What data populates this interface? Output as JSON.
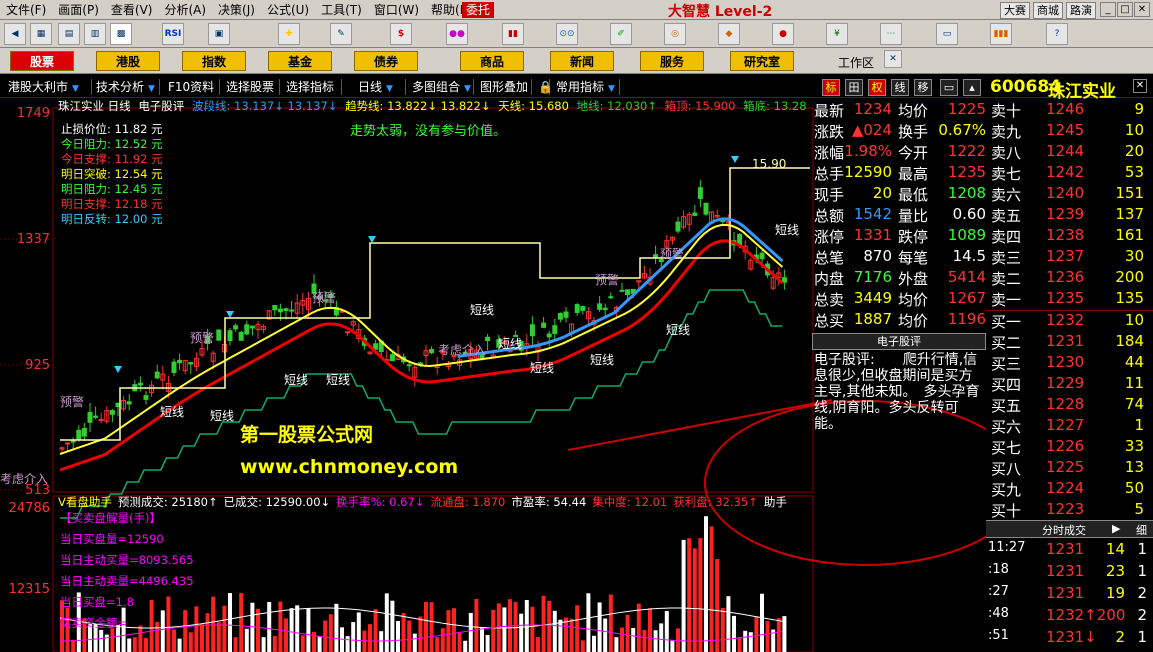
{
  "menu": {
    "items": [
      "文件(F)",
      "画面(P)",
      "查看(V)",
      "分析(A)",
      "决策(J)",
      "公式(U)",
      "工具(T)",
      "窗口(W)",
      "帮助(H)"
    ],
    "weituo": "委托",
    "brand": "大智慧 Level-2",
    "right": [
      "大赛",
      "商城",
      "路演"
    ]
  },
  "toolbar": {
    "rsi": "RSI"
  },
  "categories": [
    "股票",
    "港股",
    "指数",
    "基金",
    "债券",
    "商品",
    "新闻",
    "服务",
    "研究室"
  ],
  "workzone": "工作区",
  "subbar": {
    "items": [
      "港股大利市",
      "技术分析",
      "F10资料",
      "选择股票",
      "选择指标",
      "日线",
      "多图组合",
      "图形叠加",
      "常用指标"
    ],
    "tabs": [
      "标",
      "田",
      "权",
      "线",
      "移"
    ]
  },
  "stock": {
    "code": "600684",
    "name": "珠江实业"
  },
  "chart": {
    "header": [
      {
        "t": "珠江实业 日线",
        "c": "#fff"
      },
      {
        "t": "电子股评",
        "c": "#fff"
      },
      {
        "t": "波段线: 13.137↓ 13.137↓",
        "c": "#39f"
      },
      {
        "t": "趋势线: 13.822↓ 13.822↓",
        "c": "#ff0"
      },
      {
        "t": "天线: 15.680",
        "c": "#ff0"
      },
      {
        "t": "地线: 12.030↑",
        "c": "#3c3"
      },
      {
        "t": "箱顶: 15.900",
        "c": "#f33"
      },
      {
        "t": "箱底: 13.28",
        "c": "#3c3"
      }
    ],
    "note": "走势太弱，没有参与价值。",
    "levels": [
      {
        "t": "止损价位: 11.82 元",
        "c": "#fff"
      },
      {
        "t": "今日阻力: 12.52 元",
        "c": "#3f3"
      },
      {
        "t": "今日支撑: 11.92 元",
        "c": "#f33"
      },
      {
        "t": "明日突破: 12.54 元",
        "c": "#ff0"
      },
      {
        "t": "明日阻力: 12.45 元",
        "c": "#3f3"
      },
      {
        "t": "明日支撑: 12.18 元",
        "c": "#f33"
      },
      {
        "t": "明日反转: 12.00 元",
        "c": "#3cf"
      }
    ],
    "yaxis": [
      "1749",
      "1337",
      "925",
      "513"
    ],
    "labels": {
      "short": "短线",
      "warn": "预警",
      "consider": "考虑介入"
    },
    "peak_label": "15.90",
    "consider_left": "考虑介入",
    "watermark1": "第一股票公式网",
    "watermark2": "www.chnmoney.com"
  },
  "quotes": [
    {
      "k": "最新",
      "v": "1234",
      "vc": "#f33",
      "k2": "均价",
      "v2": "1225",
      "v2c": "#f33"
    },
    {
      "k": "涨跌",
      "v": "▲024",
      "vc": "#f33",
      "k2": "换手",
      "v2": "0.67%",
      "v2c": "#ff0"
    },
    {
      "k": "涨幅",
      "v": "1.98%",
      "vc": "#f33",
      "k2": "今开",
      "v2": "1222",
      "v2c": "#f33"
    },
    {
      "k": "总手",
      "v": "12590",
      "vc": "#ff0",
      "k2": "最高",
      "v2": "1235",
      "v2c": "#f33"
    },
    {
      "k": "现手",
      "v": "20",
      "vc": "#ff0",
      "k2": "最低",
      "v2": "1208",
      "v2c": "#3f3"
    },
    {
      "k": "总额",
      "v": "1542",
      "vc": "#39f",
      "k2": "量比",
      "v2": "0.60",
      "v2c": "#fff"
    },
    {
      "k": "涨停",
      "v": "1331",
      "vc": "#f33",
      "k2": "跌停",
      "v2": "1089",
      "v2c": "#3f3"
    },
    {
      "k": "总笔",
      "v": "870",
      "vc": "#fff",
      "k2": "每笔",
      "v2": "14.5",
      "v2c": "#fff"
    },
    {
      "k": "内盘",
      "v": "7176",
      "vc": "#3f3",
      "k2": "外盘",
      "v2": "5414",
      "v2c": "#f33"
    },
    {
      "k": "总卖",
      "v": "3449",
      "vc": "#ff0",
      "k2": "均价",
      "v2": "1267",
      "v2c": "#f33"
    },
    {
      "k": "总买",
      "v": "1887",
      "vc": "#ff0",
      "k2": "均价",
      "v2": "1196",
      "v2c": "#f33"
    }
  ],
  "comment": {
    "title": "电子股评",
    "body": "电子股评:　　爬升行情,信息很少,但收盘期间是买方主导,其他未知。　多头孕育线,阴育阳。多头反转可能。"
  },
  "asks": [
    {
      "l": "卖十",
      "p": "1246",
      "v": "9"
    },
    {
      "l": "卖九",
      "p": "1245",
      "v": "10"
    },
    {
      "l": "卖八",
      "p": "1244",
      "v": "20"
    },
    {
      "l": "卖七",
      "p": "1242",
      "v": "53"
    },
    {
      "l": "卖六",
      "p": "1240",
      "v": "151"
    },
    {
      "l": "卖五",
      "p": "1239",
      "v": "137"
    },
    {
      "l": "卖四",
      "p": "1238",
      "v": "161"
    },
    {
      "l": "卖三",
      "p": "1237",
      "v": "30"
    },
    {
      "l": "卖二",
      "p": "1236",
      "v": "200"
    },
    {
      "l": "卖一",
      "p": "1235",
      "v": "135"
    }
  ],
  "bids": [
    {
      "l": "买一",
      "p": "1232",
      "v": "10"
    },
    {
      "l": "买二",
      "p": "1231",
      "v": "184"
    },
    {
      "l": "买三",
      "p": "1230",
      "v": "44"
    },
    {
      "l": "买四",
      "p": "1229",
      "v": "11"
    },
    {
      "l": "买五",
      "p": "1228",
      "v": "74"
    },
    {
      "l": "买六",
      "p": "1227",
      "v": "1"
    },
    {
      "l": "买七",
      "p": "1226",
      "v": "33"
    },
    {
      "l": "买八",
      "p": "1225",
      "v": "13"
    },
    {
      "l": "买九",
      "p": "1224",
      "v": "50"
    },
    {
      "l": "买十",
      "p": "1223",
      "v": "5"
    }
  ],
  "ticks_title": "分时成交",
  "ticks_tab": "细",
  "ticks": [
    {
      "t": "11:27",
      "p": "1231",
      "v": "14",
      "n": "1"
    },
    {
      "t": ":18",
      "p": "1231",
      "v": "23",
      "n": "1"
    },
    {
      "t": ":27",
      "p": "1231",
      "v": "19",
      "n": "2"
    },
    {
      "t": ":48",
      "p": "1232↑200",
      "v": "",
      "n": "2"
    },
    {
      "t": ":51",
      "p": "1231↓",
      "v": "2",
      "n": "1"
    }
  ],
  "sub2": {
    "header": [
      {
        "t": "V看盘助手",
        "c": "#ff0"
      },
      {
        "t": "预测成交: 25180↑",
        "c": "#fff"
      },
      {
        "t": "已成交: 12590.00↓",
        "c": "#fff"
      },
      {
        "t": "换手率%: 0.67↓",
        "c": "#f0f"
      },
      {
        "t": "流通盘: 1.870",
        "c": "#f33"
      },
      {
        "t": "市盈率: 54.44",
        "c": "#fff"
      },
      {
        "t": "集中度: 12.01",
        "c": "#f33"
      },
      {
        "t": "获利盘: 32.35↑",
        "c": "#f33"
      },
      {
        "t": "助手",
        "c": "#fff"
      }
    ],
    "y": [
      "24786",
      "12315"
    ],
    "lines": [
      "【买卖盘解量(手)】",
      "当日买盘量=12590",
      "当日主动买量=8093.565",
      "当日主动卖量=4496.435",
      "当日买盘=1.8",
      "买卖资金额="
    ]
  }
}
